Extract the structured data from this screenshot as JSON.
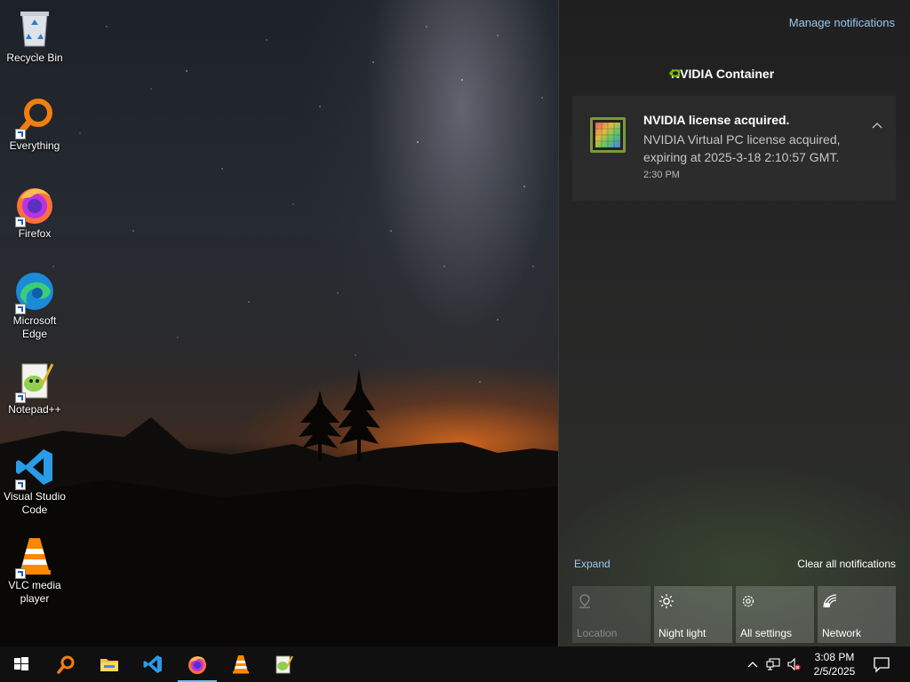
{
  "desktop": {
    "icons": [
      {
        "label": "Recycle Bin",
        "icon": "recycle-bin-icon"
      },
      {
        "label": "Everything",
        "icon": "everything-search-icon"
      },
      {
        "label": "Firefox",
        "icon": "firefox-icon"
      },
      {
        "label": "Microsoft Edge",
        "icon": "edge-icon"
      },
      {
        "label": "Notepad++",
        "icon": "notepad-plus-plus-icon"
      },
      {
        "label": "Visual Studio Code",
        "icon": "vscode-icon"
      },
      {
        "label": "VLC media player",
        "icon": "vlc-icon"
      }
    ]
  },
  "action_center": {
    "manage_label": "Manage notifications",
    "group_name": "NVIDIA Container",
    "notification": {
      "title": "NVIDIA license acquired.",
      "body": "NVIDIA Virtual PC license acquired, expiring at 2025-3-18 2:10:57 GMT.",
      "time": "2:30 PM"
    },
    "expand_label": "Expand",
    "clear_label": "Clear all notifications",
    "quick_actions": [
      {
        "label": "Location",
        "icon": "location-icon",
        "enabled": false
      },
      {
        "label": "Night light",
        "icon": "brightness-icon",
        "enabled": true
      },
      {
        "label": "All settings",
        "icon": "gear-icon",
        "enabled": true
      },
      {
        "label": "Network",
        "icon": "network-icon",
        "enabled": true
      }
    ]
  },
  "taskbar": {
    "pinned": [
      "start-icon",
      "everything-search-icon",
      "file-explorer-icon",
      "vscode-icon",
      "firefox-icon",
      "vlc-icon",
      "notepad-plus-plus-icon"
    ],
    "active": "firefox-icon",
    "tray": [
      "chevron-up-icon",
      "network-icon",
      "volume-muted-icon"
    ],
    "time": "3:08 PM",
    "date": "2/5/2025"
  },
  "colors": {
    "accent_link": "#99c8ee",
    "taskbar_bg": "#101010",
    "active_indicator": "#76b9ed",
    "action_center_bg": "#1f1f1f"
  }
}
